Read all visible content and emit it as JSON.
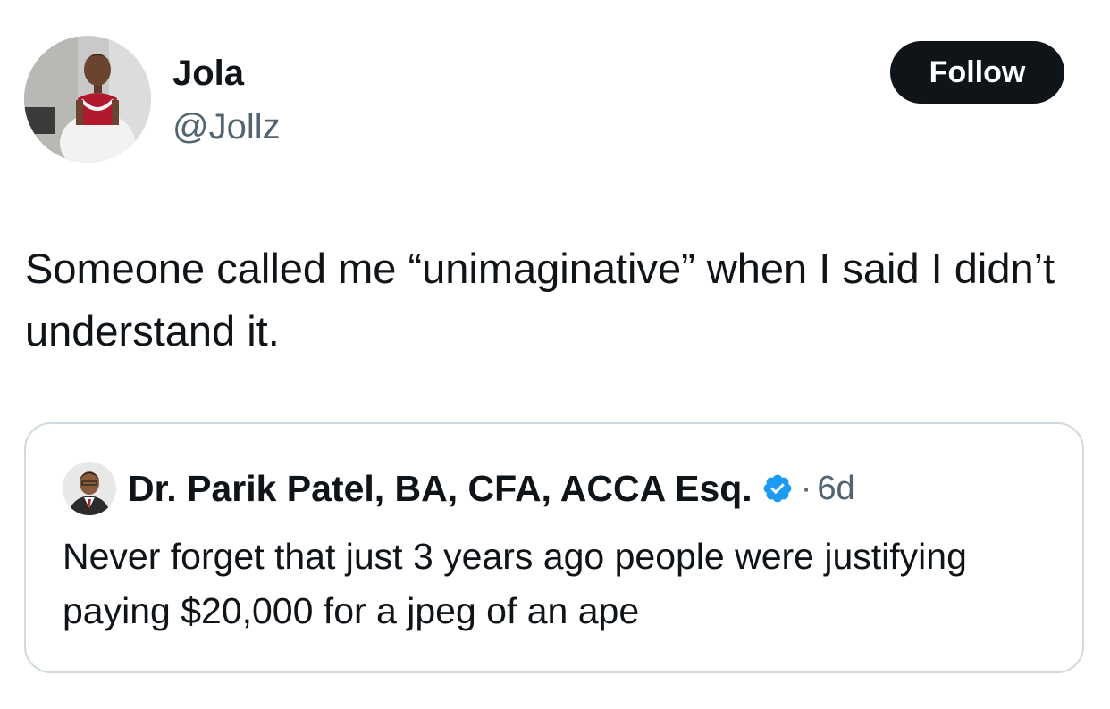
{
  "author": {
    "display_name": "Jola",
    "handle": "@Jollz",
    "avatar_icon": "profile-photo-child-in-red-dress"
  },
  "follow_label": "Follow",
  "tweet_text": "Someone called me “unimaginative” when I said I didn’t understand it.",
  "quoted_tweet": {
    "display_name": "Dr. Parik Patel, BA, CFA, ACCA Esq.",
    "verified_icon": "verified-badge-icon",
    "separator": "·",
    "time": "6d",
    "text": "Never forget that just 3 years ago people were justifying paying $20,000 for a jpeg of an ape",
    "avatar_icon": "profile-photo-man-in-suit"
  },
  "colors": {
    "text_primary": "#0f1419",
    "text_secondary": "#536471",
    "follow_bg": "#0f1419",
    "verified_blue": "#1d9bf0",
    "border": "#cfd9de"
  }
}
